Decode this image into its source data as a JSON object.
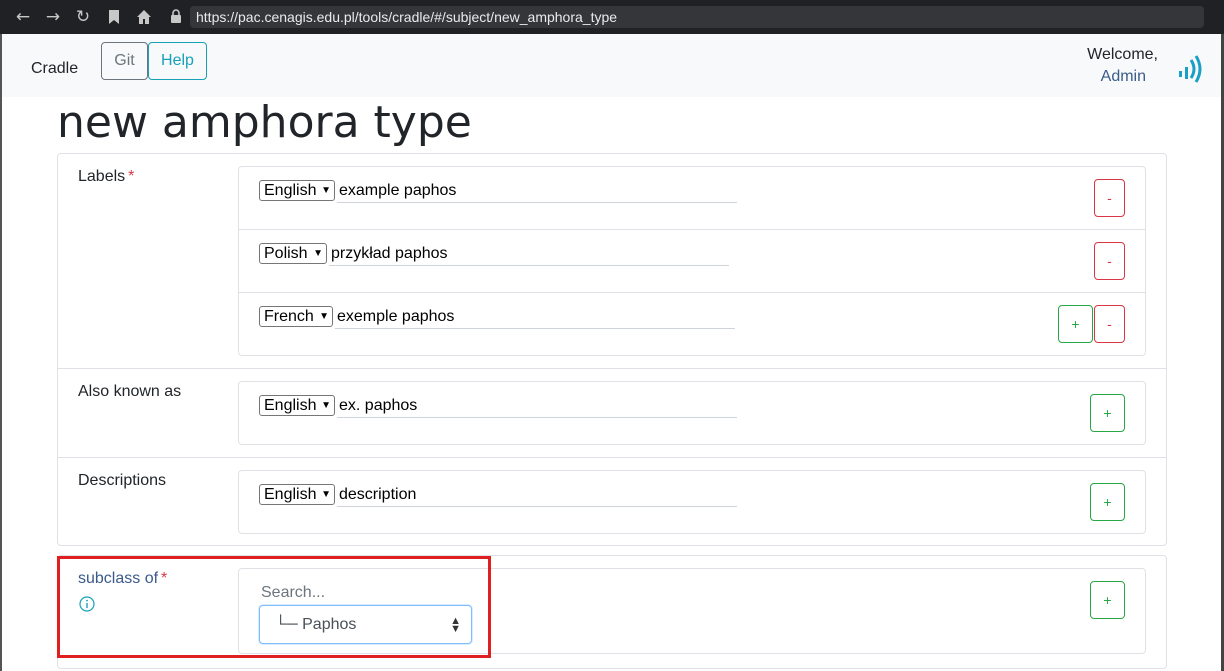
{
  "browser": {
    "url": "https://pac.cenagis.edu.pl/tools/cradle/#/subject/new_amphora_type",
    "icons": [
      "back-icon",
      "forward-icon",
      "reload-icon",
      "bookmark-icon",
      "home-icon",
      "lock-icon"
    ]
  },
  "navbar": {
    "brand": "Cradle",
    "git_label": "Git",
    "help_label": "Help",
    "welcome_text": "Welcome,",
    "user_name": "Admin",
    "logo_icon": "cradle-logo-icon"
  },
  "page": {
    "title": "new amphora type"
  },
  "fields": {
    "labels": {
      "label": "Labels",
      "required_mark": "*",
      "rows": [
        {
          "language": "English",
          "value": "example paphos"
        },
        {
          "language": "Polish",
          "value": "przykład paphos"
        },
        {
          "language": "French",
          "value": "exemple paphos"
        }
      ]
    },
    "also_known_as": {
      "label": "Also known as",
      "rows": [
        {
          "language": "English",
          "value": "ex. paphos"
        }
      ]
    },
    "descriptions": {
      "label": "Descriptions",
      "rows": [
        {
          "language": "English",
          "value": "description"
        }
      ]
    },
    "subclass_of": {
      "label": "subclass of",
      "required_mark": "*",
      "search_placeholder": "Search...",
      "selected_value": "└─ Paphos",
      "info_icon": "info-circle-icon"
    }
  },
  "buttons": {
    "add_label": "+",
    "remove_label": "-"
  },
  "colors": {
    "required": "#dc3545",
    "remove_button": "#dc3545",
    "add_button": "#28a745",
    "help_button": "#17a2b8",
    "highlight_box": "#e02020"
  }
}
